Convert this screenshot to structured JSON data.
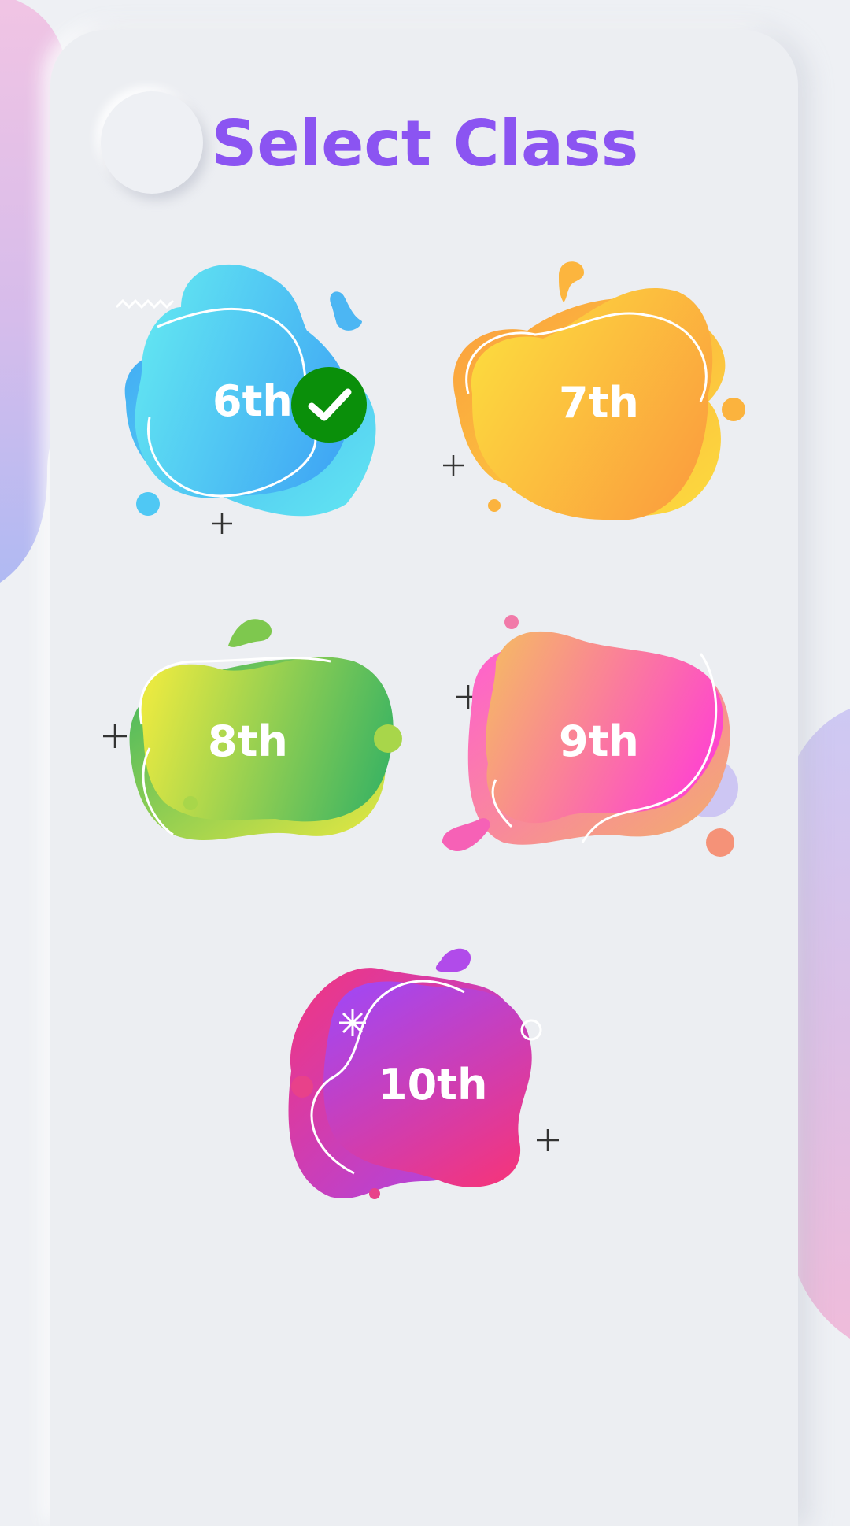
{
  "screen": {
    "title": "Select Class",
    "accent_color": "#8b54f2"
  },
  "classes": [
    {
      "label": "6th",
      "selected": true,
      "colors": [
        "#62e6f2",
        "#3fa6f4"
      ]
    },
    {
      "label": "7th",
      "selected": false,
      "colors": [
        "#fcdc3e",
        "#fb9d3e"
      ]
    },
    {
      "label": "8th",
      "selected": false,
      "colors": [
        "#e8e941",
        "#3cb462"
      ]
    },
    {
      "label": "9th",
      "selected": false,
      "colors": [
        "#f6b26b",
        "#ff3fd4"
      ]
    },
    {
      "label": "10th",
      "selected": false,
      "colors": [
        "#a447f0",
        "#f2357f"
      ]
    }
  ],
  "selected_badge": {
    "icon": "check-icon",
    "color": "#0a8f0a"
  }
}
